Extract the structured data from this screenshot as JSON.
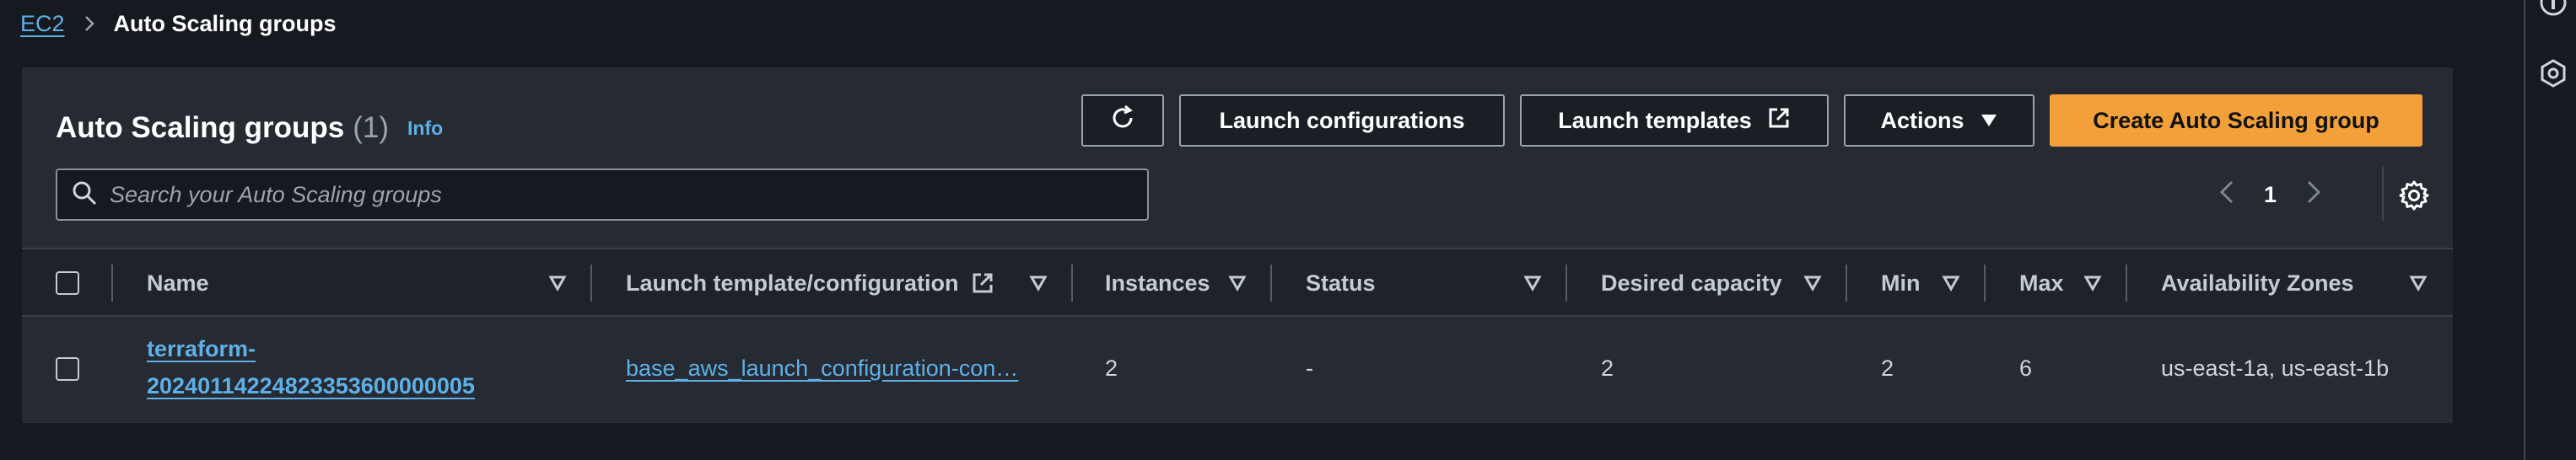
{
  "breadcrumb": {
    "root": "EC2",
    "current": "Auto Scaling groups"
  },
  "panel": {
    "title": "Auto Scaling groups",
    "count": "(1)",
    "info_label": "Info"
  },
  "toolbar": {
    "refresh_icon": "refresh-icon",
    "launch_configurations": "Launch configurations",
    "launch_templates": "Launch templates",
    "actions": "Actions",
    "create": "Create Auto Scaling group"
  },
  "search": {
    "placeholder": "Search your Auto Scaling groups",
    "value": ""
  },
  "pagination": {
    "current_page": "1"
  },
  "table": {
    "columns": [
      "Name",
      "Launch template/configuration",
      "Instances",
      "Status",
      "Desired capacity",
      "Min",
      "Max",
      "Availability Zones"
    ],
    "rows": [
      {
        "name_line1": "terraform-",
        "name_line2": "20240114224823353600000005",
        "launch_config": "base_aws_launch_configuration-con…",
        "instances": "2",
        "status": "-",
        "desired_capacity": "2",
        "min": "2",
        "max": "6",
        "availability_zones": "us-east-1a, us-east-1b"
      }
    ]
  },
  "colors": {
    "background": "#16191f",
    "panel": "#252a33",
    "link": "#5fb0e6",
    "primary_button": "#f2a03a"
  }
}
